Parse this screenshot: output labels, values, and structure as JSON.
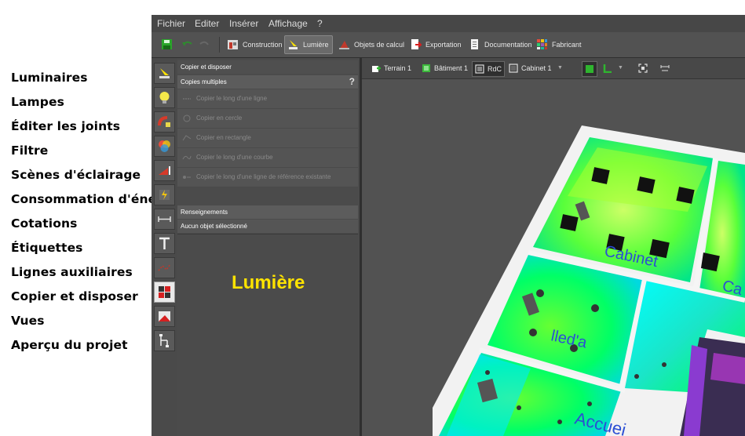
{
  "annotations": {
    "items": [
      "Luminaires",
      "Lampes",
      "Éditer les joints",
      "Filtre",
      "Scènes d'éclairage",
      "Consommation d'énergie",
      "Cotations",
      "Étiquettes",
      "Lignes auxiliaires",
      "Copier et disposer",
      "Vues",
      "Aperçu du projet"
    ],
    "highlight_label": "Lumière"
  },
  "menu": [
    "Fichier",
    "Editer",
    "Insérer",
    "Affichage",
    "?"
  ],
  "toolbar": {
    "items": [
      {
        "label": "Construction",
        "icon": "construction-icon"
      },
      {
        "label": "Lumière",
        "icon": "lamp-icon"
      },
      {
        "label": "Objets de calcul",
        "icon": "calc-object-icon"
      },
      {
        "label": "Exportation",
        "icon": "export-icon"
      },
      {
        "label": "Documentation",
        "icon": "documentation-icon"
      },
      {
        "label": "Fabricant",
        "icon": "manufacturer-icon"
      }
    ]
  },
  "panel": {
    "section1": "Copier et disposer",
    "section2": "Copies multiples",
    "help": "?",
    "items": [
      "Copier le long d'une ligne",
      "Copier en cercle",
      "Copier en rectangle",
      "Copier le long d'une courbe",
      "Copier le long d'une ligne de référence existante"
    ],
    "section3": "Renseignements",
    "section4": "Aucun objet sélectionné"
  },
  "viewport": {
    "items": [
      "Terrain 1",
      "Bâtiment 1",
      "RdC",
      "Cabinet 1"
    ],
    "room_labels": [
      "Cabinet",
      "Ca",
      "lled'a",
      "Accuei"
    ]
  },
  "colors": {
    "accent": "#ffe300",
    "false_green": "#00ff00",
    "false_cyan": "#00e5ff",
    "false_lime": "#ccff66"
  }
}
